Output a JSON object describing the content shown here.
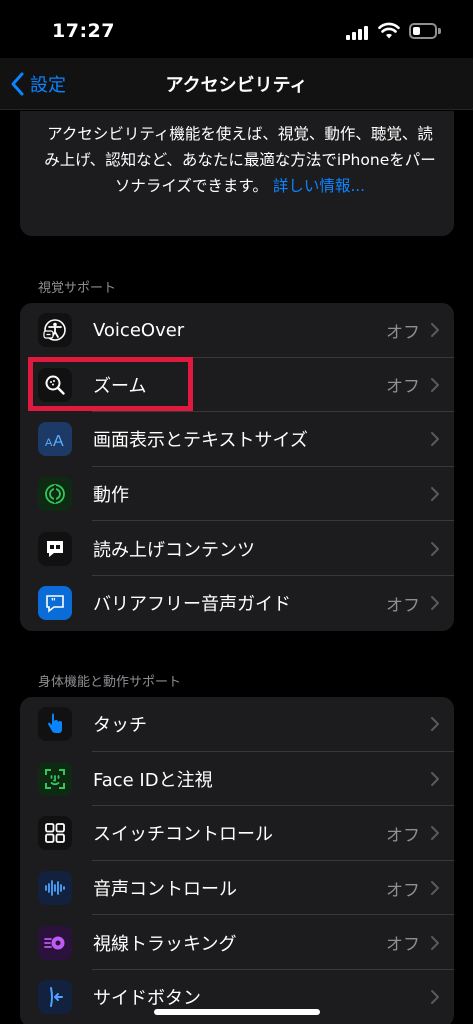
{
  "status_bar": {
    "time": "17:27"
  },
  "nav": {
    "back_label": "設定",
    "title": "アクセシビリティ"
  },
  "intro": {
    "text": "アクセシビリティ機能を使えば、視覚、動作、聴覚、読み上げ、認知など、あなたに最適な方法でiPhoneをパーソナライズできます。",
    "link": "詳しい情報..."
  },
  "vision": {
    "header": "視覚サポート",
    "items": [
      {
        "label": "VoiceOver",
        "value": "オフ",
        "icon": "voiceover-icon"
      },
      {
        "label": "ズーム",
        "value": "オフ",
        "icon": "zoom-icon"
      },
      {
        "label": "画面表示とテキストサイズ",
        "value": "",
        "icon": "text-size-icon"
      },
      {
        "label": "動作",
        "value": "",
        "icon": "motion-icon"
      },
      {
        "label": "読み上げコンテンツ",
        "value": "",
        "icon": "spoken-content-icon"
      },
      {
        "label": "バリアフリー音声ガイド",
        "value": "オフ",
        "icon": "audio-description-icon"
      }
    ]
  },
  "physical": {
    "header": "身体機能と動作サポート",
    "items": [
      {
        "label": "タッチ",
        "value": "",
        "icon": "touch-icon"
      },
      {
        "label": "Face IDと注視",
        "value": "",
        "icon": "face-id-icon"
      },
      {
        "label": "スイッチコントロール",
        "value": "オフ",
        "icon": "switch-control-icon"
      },
      {
        "label": "音声コントロール",
        "value": "オフ",
        "icon": "voice-control-icon"
      },
      {
        "label": "視線トラッキング",
        "value": "オフ",
        "icon": "eye-tracking-icon"
      },
      {
        "label": "サイドボタン",
        "value": "",
        "icon": "side-button-icon"
      }
    ]
  },
  "colors": {
    "accent": "#0a84ff",
    "highlight": "#e0193f",
    "group_bg": "#1c1c1e"
  }
}
